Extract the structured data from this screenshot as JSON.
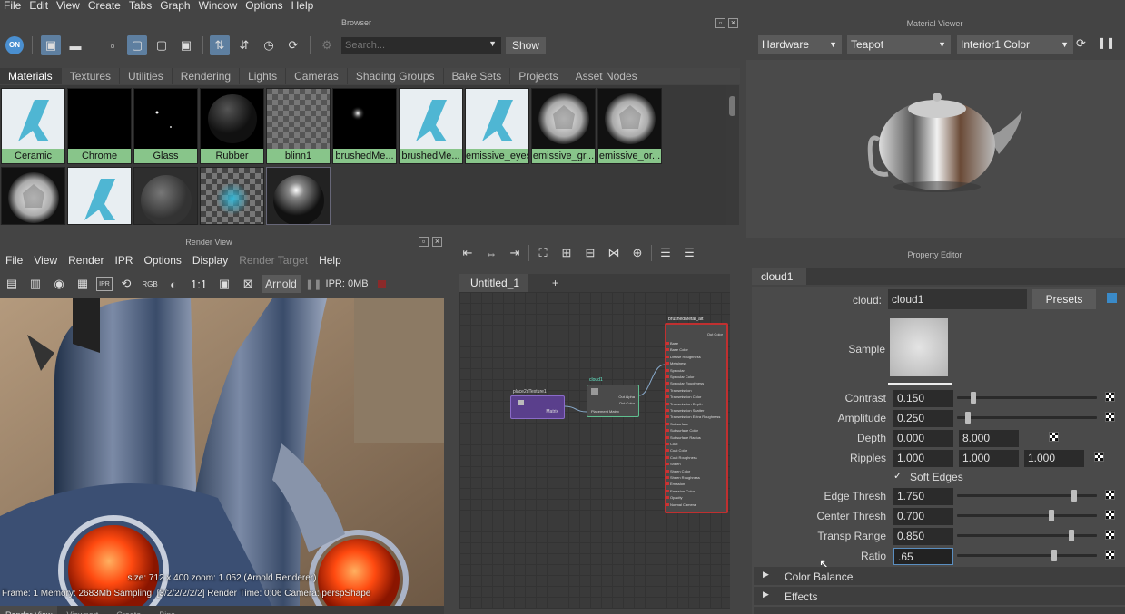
{
  "menubar": [
    "File",
    "Edit",
    "View",
    "Create",
    "Tabs",
    "Graph",
    "Window",
    "Options",
    "Help"
  ],
  "browser": {
    "title": "Browser",
    "toggle_label": "ON",
    "search_placeholder": "Search...",
    "show_label": "Show",
    "tabs": [
      "Materials",
      "Textures",
      "Utilities",
      "Rendering",
      "Lights",
      "Cameras",
      "Shading Groups",
      "Bake Sets",
      "Projects",
      "Asset Nodes"
    ],
    "swatches_row1": [
      "Ceramic",
      "Chrome",
      "Glass",
      "Rubber",
      "blinn1",
      "brushedMe...",
      "brushedMe...",
      "emissive_eyes",
      "emissive_gr...",
      "emissive_or..."
    ]
  },
  "material_viewer": {
    "title": "Material Viewer",
    "renderer": "Hardware",
    "shape": "Teapot",
    "lighting": "Interior1 Color"
  },
  "render_view": {
    "title": "Render View",
    "menu": [
      "File",
      "View",
      "Render",
      "IPR",
      "Options",
      "Display",
      "Render Target",
      "Help"
    ],
    "ratio_label": "1:1",
    "rgb_label": "RGB",
    "ipr_icon_label": "IPR",
    "renderer_label": "Arnold I",
    "ipr_mem": "IPR: 0MB",
    "info_line1": "size:  712 x 400  zoom: 1.052       (Arnold Renderer)",
    "info_line2": "Frame: 1     Memory: 2683Mb     Sampling: [3/2/2/2/2/2]     Render Time: 0:06     Camera: perspShape",
    "bottom_tabs": [
      "Render View",
      "Viewport",
      "Create",
      "Bins"
    ]
  },
  "node_editor": {
    "tab": "Untitled_1",
    "add_tab": "+",
    "node_place": {
      "title": "place2dTexture1",
      "port": "Matrix"
    },
    "node_cloud": {
      "title": "cloud1",
      "ports": [
        "Out Alpha",
        "Out Color",
        "Placement Matrix"
      ]
    },
    "node_shader": {
      "title": "brushedMetal_alt",
      "out": "Out Color",
      "ports": [
        "Base",
        "Base Color",
        "Diffuse Roughness",
        "Metalness",
        "Specular",
        "Specular Color",
        "Specular Roughness",
        "Transmission",
        "Transmission Color",
        "Transmission Depth",
        "Transmission Scatter",
        "Transmission Extra Roughness",
        "Subsurface",
        "Subsurface Color",
        "Subsurface Radius",
        "Coat",
        "Coat Color",
        "Coat Roughness",
        "Sheen",
        "Sheen Color",
        "Sheen Roughness",
        "Emission",
        "Emission Color",
        "Opacity",
        "Normal Camera"
      ]
    }
  },
  "property_editor": {
    "title": "Property Editor",
    "tab": "cloud1",
    "name_label": "cloud:",
    "name_value": "cloud1",
    "presets_label": "Presets",
    "sample_label": "Sample",
    "contrast": {
      "label": "Contrast",
      "value": "0.150",
      "level": 0.1
    },
    "amplitude": {
      "label": "Amplitude",
      "value": "0.250",
      "level": 0.06
    },
    "depth": {
      "label": "Depth",
      "v1": "0.000",
      "v2": "8.000"
    },
    "ripples": {
      "label": "Ripples",
      "v1": "1.000",
      "v2": "1.000",
      "v3": "1.000"
    },
    "soft_edges": "Soft Edges",
    "edge_thresh": {
      "label": "Edge Thresh",
      "value": "1.750",
      "level": 0.85
    },
    "center_thresh": {
      "label": "Center Thresh",
      "value": "0.700",
      "level": 0.68
    },
    "transp_range": {
      "label": "Transp Range",
      "value": "0.850",
      "level": 0.83
    },
    "ratio": {
      "label": "Ratio",
      "value": ".65",
      "level": 0.7
    },
    "sections": [
      "Color Balance",
      "Effects"
    ]
  }
}
